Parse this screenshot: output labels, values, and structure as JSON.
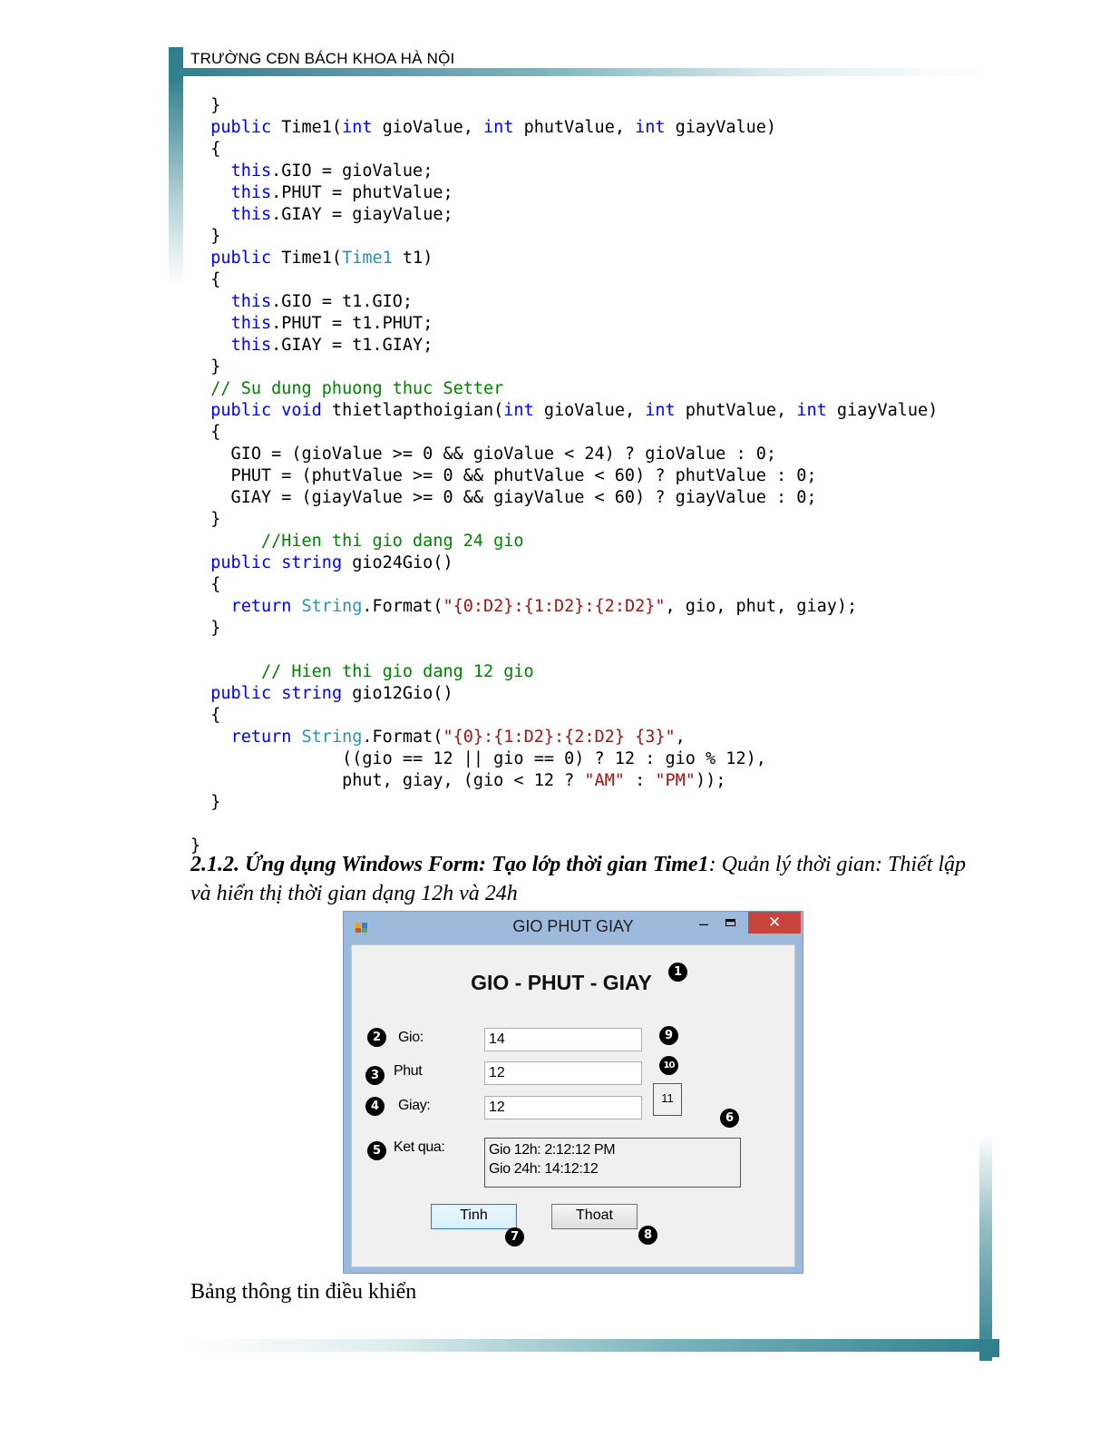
{
  "header": {
    "text": "TRƯỜNG CĐN BÁCH KHOA HÀ NỘI"
  },
  "code": {
    "lines": [
      [
        {
          "t": "  }"
        }
      ],
      [
        {
          "t": "  "
        },
        {
          "t": "public",
          "c": "kw"
        },
        {
          "t": " Time1("
        },
        {
          "t": "int",
          "c": "kw"
        },
        {
          "t": " gioValue, "
        },
        {
          "t": "int",
          "c": "kw"
        },
        {
          "t": " phutValue, "
        },
        {
          "t": "int",
          "c": "kw"
        },
        {
          "t": " giayValue)"
        }
      ],
      [
        {
          "t": "  {"
        }
      ],
      [
        {
          "t": "    "
        },
        {
          "t": "this",
          "c": "kw"
        },
        {
          "t": ".GIO = gioValue;"
        }
      ],
      [
        {
          "t": "    "
        },
        {
          "t": "this",
          "c": "kw"
        },
        {
          "t": ".PHUT = phutValue;"
        }
      ],
      [
        {
          "t": "    "
        },
        {
          "t": "this",
          "c": "kw"
        },
        {
          "t": ".GIAY = giayValue;"
        }
      ],
      [
        {
          "t": "  }"
        }
      ],
      [
        {
          "t": "  "
        },
        {
          "t": "public",
          "c": "kw"
        },
        {
          "t": " Time1("
        },
        {
          "t": "Time1",
          "c": "ty"
        },
        {
          "t": " t1)"
        }
      ],
      [
        {
          "t": "  {"
        }
      ],
      [
        {
          "t": "    "
        },
        {
          "t": "this",
          "c": "kw"
        },
        {
          "t": ".GIO = t1.GIO;"
        }
      ],
      [
        {
          "t": "    "
        },
        {
          "t": "this",
          "c": "kw"
        },
        {
          "t": ".PHUT = t1.PHUT;"
        }
      ],
      [
        {
          "t": "    "
        },
        {
          "t": "this",
          "c": "kw"
        },
        {
          "t": ".GIAY = t1.GIAY;"
        }
      ],
      [
        {
          "t": "  }"
        }
      ],
      [
        {
          "t": "  "
        },
        {
          "t": "// Su dung phuong thuc Setter",
          "c": "cm"
        }
      ],
      [
        {
          "t": "  "
        },
        {
          "t": "public",
          "c": "kw"
        },
        {
          "t": " "
        },
        {
          "t": "void",
          "c": "kw"
        },
        {
          "t": " thietlapthoigian("
        },
        {
          "t": "int",
          "c": "kw"
        },
        {
          "t": " gioValue, "
        },
        {
          "t": "int",
          "c": "kw"
        },
        {
          "t": " phutValue, "
        },
        {
          "t": "int",
          "c": "kw"
        },
        {
          "t": " giayValue)"
        }
      ],
      [
        {
          "t": "  {"
        }
      ],
      [
        {
          "t": "    GIO = (gioValue >= 0 && gioValue < 24) ? gioValue : 0;"
        }
      ],
      [
        {
          "t": "    PHUT = (phutValue >= 0 && phutValue < 60) ? phutValue : 0;"
        }
      ],
      [
        {
          "t": "    GIAY = (giayValue >= 0 && giayValue < 60) ? giayValue : 0;"
        }
      ],
      [
        {
          "t": "  }"
        }
      ],
      [
        {
          "t": "       "
        },
        {
          "t": "//Hien thi gio dang 24 gio",
          "c": "cm"
        }
      ],
      [
        {
          "t": "  "
        },
        {
          "t": "public",
          "c": "kw"
        },
        {
          "t": " "
        },
        {
          "t": "string",
          "c": "kw"
        },
        {
          "t": " gio24Gio()"
        }
      ],
      [
        {
          "t": "  {"
        }
      ],
      [
        {
          "t": "    "
        },
        {
          "t": "return",
          "c": "kw"
        },
        {
          "t": " "
        },
        {
          "t": "String",
          "c": "ty"
        },
        {
          "t": ".Format("
        },
        {
          "t": "\"{0:D2}:{1:D2}:{2:D2}\"",
          "c": "str"
        },
        {
          "t": ", gio, phut, giay);"
        }
      ],
      [
        {
          "t": "  }"
        }
      ],
      [
        {
          "t": ""
        }
      ],
      [
        {
          "t": "       "
        },
        {
          "t": "// Hien thi gio dang 12 gio",
          "c": "cm"
        }
      ],
      [
        {
          "t": "  "
        },
        {
          "t": "public",
          "c": "kw"
        },
        {
          "t": " "
        },
        {
          "t": "string",
          "c": "kw"
        },
        {
          "t": " gio12Gio()"
        }
      ],
      [
        {
          "t": "  {"
        }
      ],
      [
        {
          "t": "    "
        },
        {
          "t": "return",
          "c": "kw"
        },
        {
          "t": " "
        },
        {
          "t": "String",
          "c": "ty"
        },
        {
          "t": ".Format("
        },
        {
          "t": "\"{0}:{1:D2}:{2:D2} {3}\"",
          "c": "str"
        },
        {
          "t": ","
        }
      ],
      [
        {
          "t": "               ((gio == 12 || gio == 0) ? 12 : gio % 12),"
        }
      ],
      [
        {
          "t": "               phut, giay, (gio < 12 ? "
        },
        {
          "t": "\"AM\"",
          "c": "str"
        },
        {
          "t": " : "
        },
        {
          "t": "\"PM\"",
          "c": "str"
        },
        {
          "t": "));"
        }
      ],
      [
        {
          "t": "  }"
        }
      ],
      [
        {
          "t": ""
        }
      ],
      [
        {
          "t": "}"
        }
      ]
    ]
  },
  "section": {
    "bold_part": "2.1.2. Ứng dụng Windows Form: Tạo lớp thời gian Time1",
    "italic_part": ": Quản lý thời gian: Thiết lập và hiển thị thời gian dạng 12h và 24h"
  },
  "window": {
    "title": "GIO PHUT GIAY",
    "minimize_glyph": "–",
    "close_glyph": "✕",
    "form_title": "GIO - PHUT - GIAY",
    "labels": {
      "gio": "Gio:",
      "phut": "Phut",
      "giay": "Giay:",
      "ketqua": "Ket qua:"
    },
    "inputs": {
      "gio": "14",
      "phut": "12",
      "giay": "12"
    },
    "small_box_value": "11",
    "result_lines": [
      "Gio 12h: 2:12:12 PM",
      "Gio 24h: 14:12:12"
    ],
    "buttons": {
      "tinh": "Tinh",
      "thoat": "Thoat"
    },
    "markers": [
      "1",
      "2",
      "3",
      "4",
      "5",
      "6",
      "7",
      "8",
      "9",
      "10"
    ]
  },
  "caption": "Bảng thông tin điều khiển",
  "colors": {
    "accent": "#2f7f8c",
    "keyword": "#0000ff",
    "type": "#2b91af",
    "string": "#a31515",
    "comment": "#008000",
    "close_button": "#c8453d"
  }
}
